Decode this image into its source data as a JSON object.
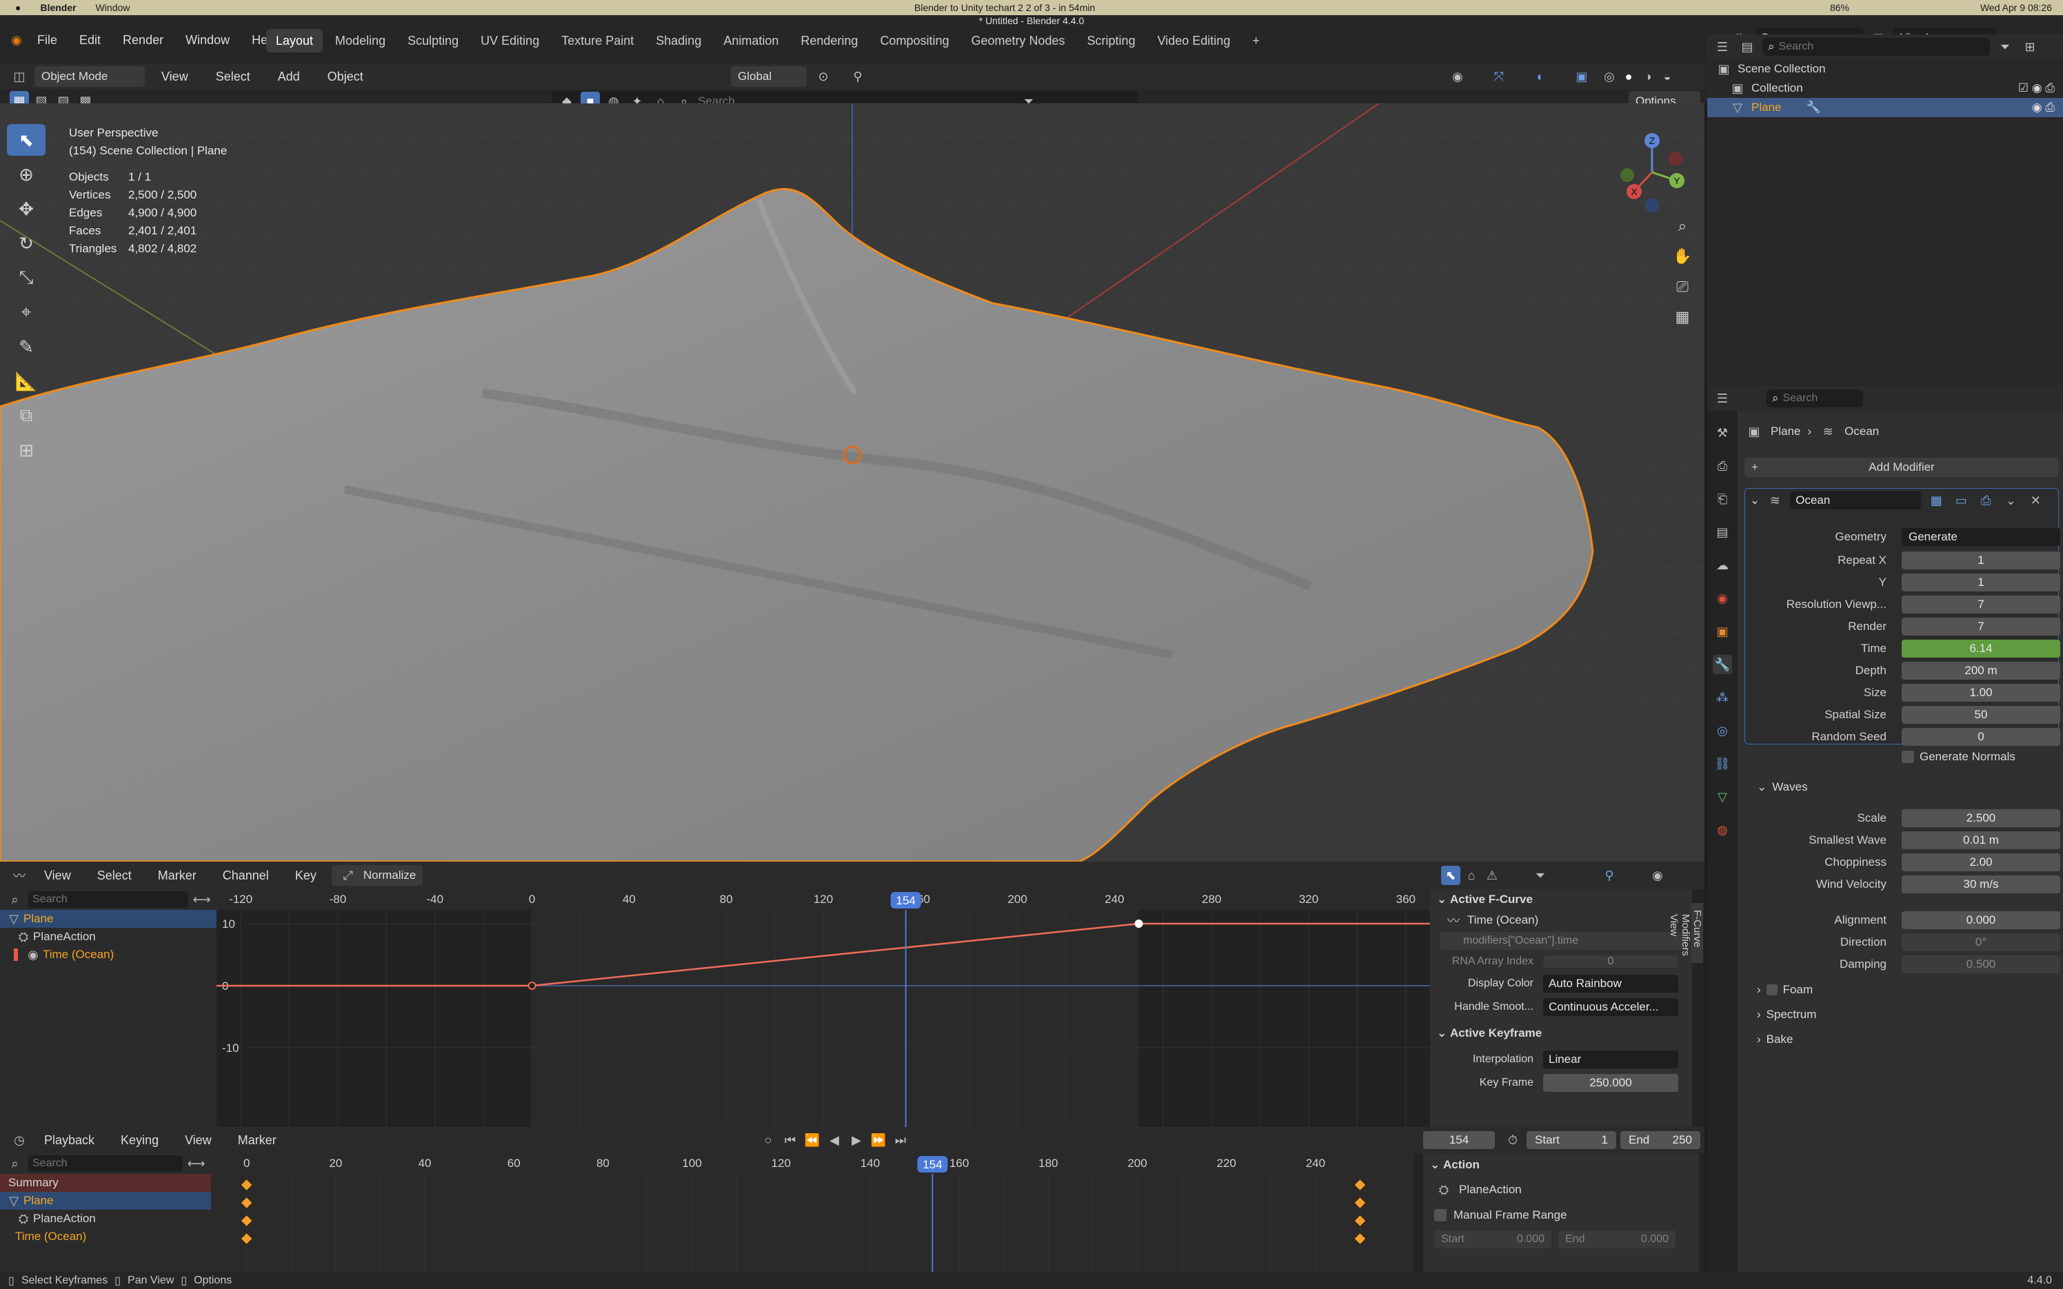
{
  "os": {
    "app": "Blender",
    "menu_window": "Window",
    "center": "Blender to Unity techart 2 2 of 3 - in 54min",
    "battery": "86%",
    "datetime": "Wed Apr 9  08:26"
  },
  "window_title": "* Untitled - Blender 4.4.0",
  "main_menu": [
    "File",
    "Edit",
    "Render",
    "Window",
    "Help"
  ],
  "workspaces": [
    "Layout",
    "Modeling",
    "Sculpting",
    "UV Editing",
    "Texture Paint",
    "Shading",
    "Animation",
    "Rendering",
    "Compositing",
    "Geometry Nodes",
    "Scripting",
    "Video Editing"
  ],
  "active_workspace": "Layout",
  "scene": {
    "name": "Scene",
    "view_layer": "ViewLayer"
  },
  "viewport_header": {
    "mode": "Object Mode",
    "menus": [
      "View",
      "Select",
      "Add",
      "Object"
    ],
    "transform": "Global",
    "search_placeholder": "Search",
    "options": "Options"
  },
  "viewport_overlay": {
    "title": "User Perspective",
    "subtitle": "(154) Scene Collection | Plane",
    "stats": [
      {
        "label": "Objects",
        "value": "1 / 1"
      },
      {
        "label": "Vertices",
        "value": "2,500 / 2,500"
      },
      {
        "label": "Edges",
        "value": "4,900 / 4,900"
      },
      {
        "label": "Faces",
        "value": "2,401 / 2,401"
      },
      {
        "label": "Triangles",
        "value": "4,802 / 4,802"
      }
    ],
    "gizmo": {
      "x": "X",
      "y": "Y",
      "z": "Z"
    }
  },
  "outliner": {
    "search_placeholder": "Search",
    "root": "Scene Collection",
    "collection": "Collection",
    "object": "Plane"
  },
  "properties": {
    "search_placeholder": "Search",
    "breadcrumb_object": "Plane",
    "breadcrumb_modifier": "Ocean",
    "add_modifier": "Add Modifier",
    "modifier_name": "Ocean",
    "fields": [
      {
        "label": "Geometry",
        "value": "Generate",
        "kind": "dropdown"
      },
      {
        "label": "Repeat X",
        "value": "1"
      },
      {
        "label": "Y",
        "value": "1"
      },
      {
        "label": "Resolution Viewp...",
        "value": "7"
      },
      {
        "label": "Render",
        "value": "7"
      },
      {
        "label": "Time",
        "value": "6.14",
        "kind": "animated"
      },
      {
        "label": "Depth",
        "value": "200 m"
      },
      {
        "label": "Size",
        "value": "1.00"
      },
      {
        "label": "Spatial Size",
        "value": "50"
      },
      {
        "label": "Random Seed",
        "value": "0"
      }
    ],
    "generate_normals": "Generate Normals",
    "waves_header": "Waves",
    "waves": [
      {
        "label": "Scale",
        "value": "2.500"
      },
      {
        "label": "Smallest Wave",
        "value": "0.01 m"
      },
      {
        "label": "Choppiness",
        "value": "2.00"
      },
      {
        "label": "Wind Velocity",
        "value": "30 m/s"
      }
    ],
    "align": [
      {
        "label": "Alignment",
        "value": "0.000"
      },
      {
        "label": "Direction",
        "value": "0°"
      },
      {
        "label": "Damping",
        "value": "0.500"
      }
    ],
    "foam": "Foam",
    "spectrum": "Spectrum",
    "bake": "Bake"
  },
  "graph_editor": {
    "menus": [
      "View",
      "Select",
      "Marker",
      "Channel",
      "Key"
    ],
    "normalize": "Normalize",
    "search_placeholder": "Search",
    "channels": [
      "Plane",
      "PlaneAction",
      "Time (Ocean)"
    ],
    "x_ticks": [
      "-120",
      "-80",
      "-40",
      "0",
      "40",
      "80",
      "120",
      "160",
      "200",
      "240",
      "280",
      "320",
      "360"
    ],
    "y_ticks": [
      "10",
      "0",
      "-10"
    ],
    "current_frame": "154",
    "curve_keys": [
      {
        "frame": 0,
        "value": 0
      },
      {
        "frame": 250,
        "value": 10
      }
    ],
    "sidebar": {
      "active_fcurve": "Active F-Curve",
      "curve_name": "Time (Ocean)",
      "data_path": "modifiers[\"Ocean\"].time",
      "rna_label": "RNA Array Index",
      "rna_value": "0",
      "display_color_label": "Display Color",
      "display_color_value": "Auto Rainbow",
      "handle_label": "Handle Smoot...",
      "handle_value": "Continuous Acceler...",
      "active_keyframe": "Active Keyframe",
      "interp_label": "Interpolation",
      "interp_value": "Linear",
      "keyframe_label": "Key Frame",
      "keyframe_value": "250.000"
    },
    "tabs": [
      "F-Curve",
      "Modifiers",
      "View"
    ]
  },
  "timeline": {
    "menus": [
      "Playback",
      "Keying",
      "View",
      "Marker"
    ],
    "current": "154",
    "start_label": "Start",
    "start_value": "1",
    "end_label": "End",
    "end_value": "250",
    "search_placeholder": "Search",
    "channels": [
      "Summary",
      "Plane",
      "PlaneAction",
      "Time (Ocean)"
    ],
    "ticks": [
      "0",
      "20",
      "40",
      "60",
      "80",
      "100",
      "120",
      "140",
      "160",
      "180",
      "200",
      "220",
      "240"
    ],
    "keyframes": [
      0,
      250
    ],
    "action_panel": {
      "title": "Action",
      "name": "PlaneAction",
      "manual": "Manual Frame Range",
      "start_label": "Start",
      "start_value": "0.000",
      "end_label": "End",
      "end_value": "0.000"
    }
  },
  "status_bar": {
    "items": [
      "Select Keyframes",
      "Pan View",
      "Options"
    ],
    "version": "4.4.0"
  },
  "colors": {
    "accent": "#4772b3",
    "selection": "#f5a623",
    "time_field": "#5f9c3f",
    "curve": "#f06c5c",
    "current_frame": "#4b7ad8"
  }
}
